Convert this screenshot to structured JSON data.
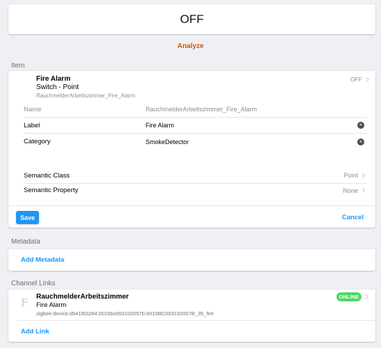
{
  "state": {
    "value": "OFF"
  },
  "analyze_label": "Analyze",
  "sections": {
    "item": "Item",
    "metadata": "Metadata",
    "channel_links": "Channel Links"
  },
  "item": {
    "label": "Fire Alarm",
    "type": "Switch - Point",
    "name": "RauchmelderArbeitszimmer_Fire_Alarm",
    "state": "OFF",
    "icon": "empty-icon"
  },
  "form": {
    "name_label": "Name",
    "name_value": "RauchmelderArbeitszimmer_Fire_Alarm",
    "label_label": "Label",
    "label_value": "Fire Alarm",
    "category_label": "Category",
    "category_value": "SmokeDetector",
    "semantic_class_label": "Semantic Class",
    "semantic_class_value": "Point",
    "semantic_property_label": "Semantic Property",
    "semantic_property_value": "None"
  },
  "actions": {
    "save": "Save",
    "cancel": "Cancel"
  },
  "metadata": {
    "add_label": "Add Metadata"
  },
  "channel_link": {
    "thing": "RauchmelderArbeitszimmer",
    "channel": "Fire Alarm",
    "uid": "zigbee:device:d541f83264:0015bc003102057b:0015BC003102057B_35_fire",
    "status": "ONLINE",
    "icon": "F"
  },
  "add_link_label": "Add Link",
  "colors": {
    "accent": "#2196f3",
    "analyze": "#d35400",
    "online": "#4cd964",
    "background": "#efeff4"
  }
}
